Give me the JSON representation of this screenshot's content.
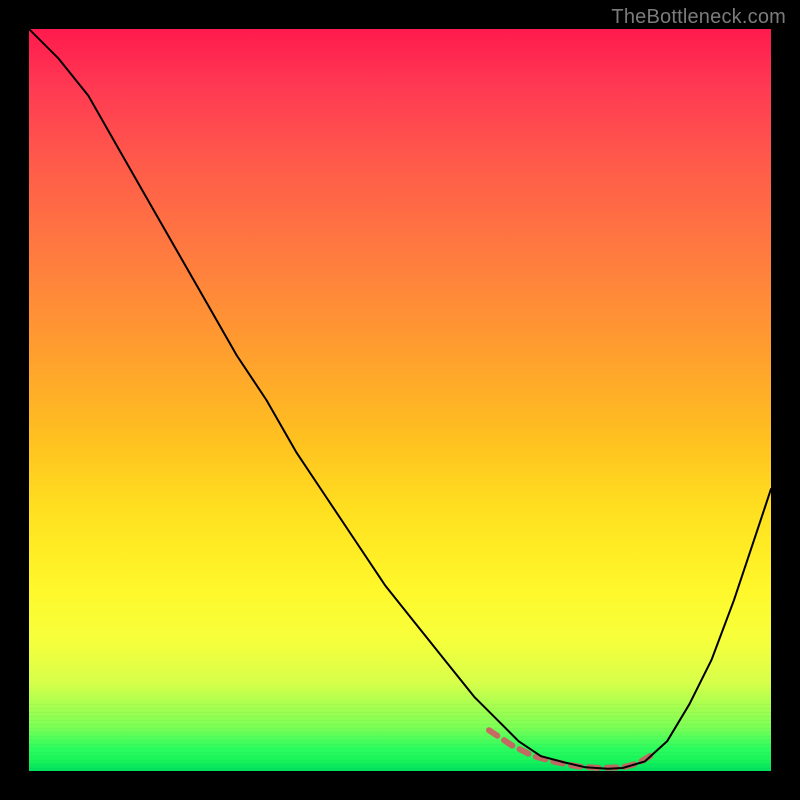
{
  "watermark": "TheBottleneck.com",
  "colors": {
    "background": "#000000",
    "curve": "#000000",
    "dash": "#d25a63",
    "gradient_top": "#ff1a4d",
    "gradient_bottom": "#00e060"
  },
  "chart_data": {
    "type": "line",
    "title": "",
    "xlabel": "",
    "ylabel": "",
    "xlim": [
      0,
      100
    ],
    "ylim": [
      0,
      100
    ],
    "grid": false,
    "legend_position": "none",
    "background_gradient": {
      "direction": "vertical",
      "stops": [
        {
          "pos": 0,
          "color": "#ff1a4d"
        },
        {
          "pos": 18,
          "color": "#ff5a4a"
        },
        {
          "pos": 42,
          "color": "#ff9a30"
        },
        {
          "pos": 65,
          "color": "#ffe020"
        },
        {
          "pos": 82,
          "color": "#f7ff3a"
        },
        {
          "pos": 94,
          "color": "#7dff55"
        },
        {
          "pos": 100,
          "color": "#00e060"
        }
      ]
    },
    "series": [
      {
        "name": "bottleneck-curve",
        "color": "#000000",
        "x": [
          0,
          4,
          8,
          12,
          16,
          20,
          24,
          28,
          32,
          36,
          40,
          44,
          48,
          52,
          56,
          60,
          63,
          66,
          69,
          72,
          75,
          78,
          80,
          83,
          86,
          89,
          92,
          95,
          98,
          100
        ],
        "y": [
          100,
          96,
          91,
          84,
          77,
          70,
          63,
          56,
          50,
          43,
          37,
          31,
          25,
          20,
          15,
          10,
          7,
          4,
          2,
          1.2,
          0.5,
          0.3,
          0.4,
          1.3,
          4,
          9,
          15,
          23,
          32,
          38
        ]
      },
      {
        "name": "optimal-band-marker",
        "color": "#d25a63",
        "style": "dashed",
        "x": [
          62,
          65,
          68,
          71,
          74,
          77,
          80,
          82,
          84
        ],
        "y": [
          5.5,
          3.5,
          2.0,
          1.2,
          0.6,
          0.4,
          0.5,
          1.0,
          2.2
        ]
      }
    ],
    "annotations": []
  }
}
